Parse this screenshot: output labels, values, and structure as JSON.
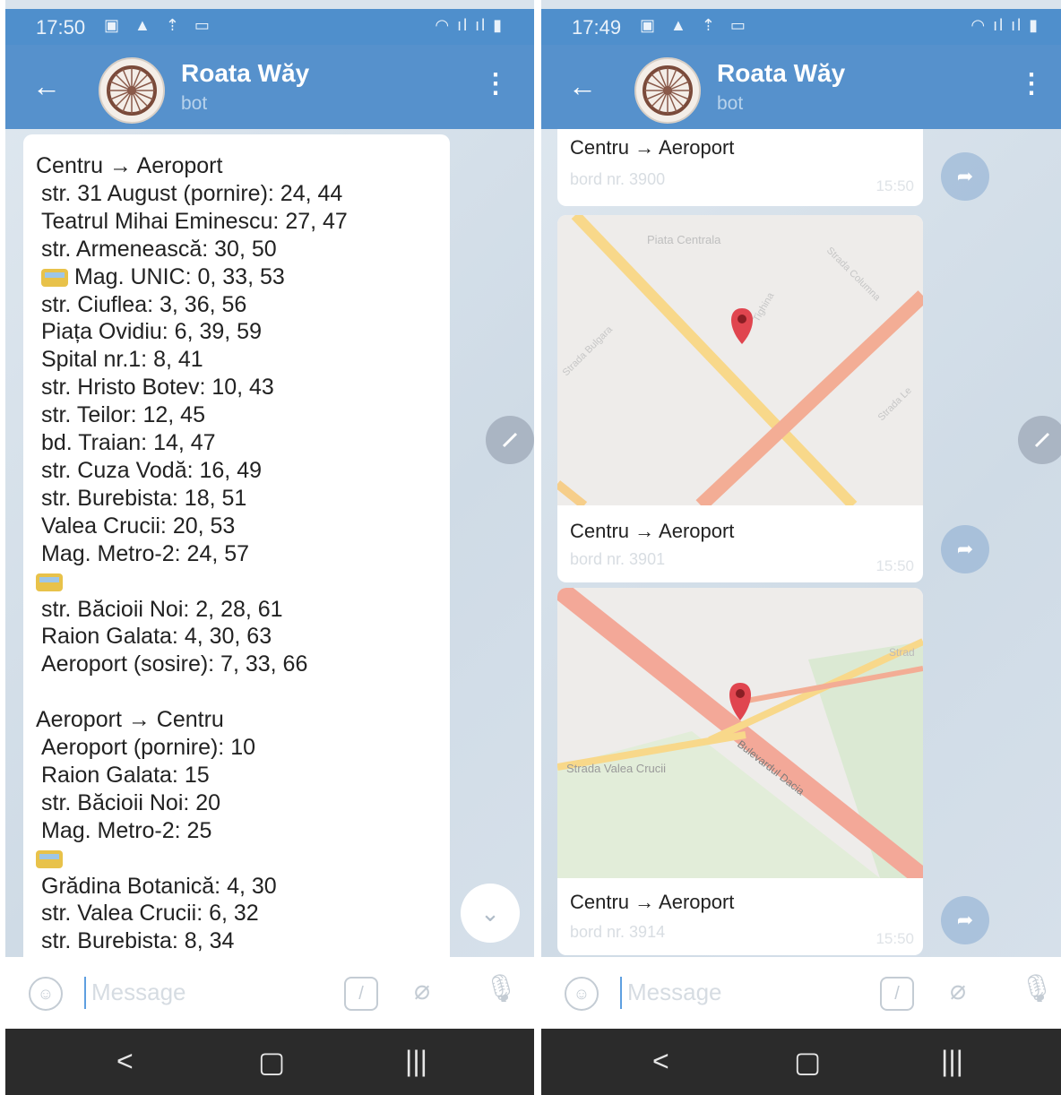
{
  "left": {
    "status": {
      "time": "17:50"
    },
    "chat": {
      "name": "Roata Wăy",
      "subtitle": "bot"
    },
    "message_lines": [
      {
        "text": "Centru → Aeroport",
        "indent": false,
        "bus": false
      },
      {
        "text": "str. 31 August (pornire): 24, 44",
        "indent": true,
        "bus": false
      },
      {
        "text": "Teatrul Mihai Eminescu: 27, 47",
        "indent": true,
        "bus": false
      },
      {
        "text": "str. Armenească: 30, 50",
        "indent": true,
        "bus": false
      },
      {
        "text": " Mag. UNIC: 0, 33, 53",
        "indent": true,
        "bus": true
      },
      {
        "text": "str. Ciuflea: 3, 36, 56",
        "indent": true,
        "bus": false
      },
      {
        "text": "Piața Ovidiu: 6, 39, 59",
        "indent": true,
        "bus": false
      },
      {
        "text": "Spital nr.1: 8, 41",
        "indent": true,
        "bus": false
      },
      {
        "text": "str. Hristo Botev: 10, 43",
        "indent": true,
        "bus": false
      },
      {
        "text": "str. Teilor: 12, 45",
        "indent": true,
        "bus": false
      },
      {
        "text": "bd. Traian: 14, 47",
        "indent": true,
        "bus": false
      },
      {
        "text": "str. Cuza Vodă: 16, 49",
        "indent": true,
        "bus": false
      },
      {
        "text": "str. Burebista: 18, 51",
        "indent": true,
        "bus": false
      },
      {
        "text": "Valea Crucii: 20, 53",
        "indent": true,
        "bus": false
      },
      {
        "text": "Mag. Metro-2: 24, 57",
        "indent": true,
        "bus": false
      },
      {
        "text": "",
        "indent": false,
        "bus": true
      },
      {
        "text": "str. Băcioii Noi: 2, 28, 61",
        "indent": true,
        "bus": false
      },
      {
        "text": "Raion Galata: 4, 30, 63",
        "indent": true,
        "bus": false
      },
      {
        "text": "Aeroport (sosire): 7, 33, 66",
        "indent": true,
        "bus": false
      },
      {
        "text": "",
        "indent": false,
        "bus": false
      },
      {
        "text": "Aeroport → Centru",
        "indent": false,
        "bus": false
      },
      {
        "text": "Aeroport (pornire): 10",
        "indent": true,
        "bus": false
      },
      {
        "text": "Raion Galata: 15",
        "indent": true,
        "bus": false
      },
      {
        "text": "str. Băcioii Noi: 20",
        "indent": true,
        "bus": false
      },
      {
        "text": "Mag. Metro-2: 25",
        "indent": true,
        "bus": false
      },
      {
        "text": "",
        "indent": false,
        "bus": true
      },
      {
        "text": "Grădina Botanică: 4, 30",
        "indent": true,
        "bus": false
      },
      {
        "text": "str. Valea Crucii: 6, 32",
        "indent": true,
        "bus": false
      },
      {
        "text": "str. Burebista: 8, 34",
        "indent": true,
        "bus": false
      }
    ],
    "input_placeholder": "Message"
  },
  "right": {
    "status": {
      "time": "17:49"
    },
    "chat": {
      "name": "Roata Wăy",
      "subtitle": "bot"
    },
    "cards": [
      {
        "title": "Centru → Aeroport",
        "meta": "bord nr. 3900",
        "time": "15:50",
        "map": "none"
      },
      {
        "title": "Centru → Aeroport",
        "meta": "bord nr. 3901",
        "time": "15:50",
        "map": "map1"
      },
      {
        "title": "Centru → Aeroport",
        "meta": "bord nr. 3914",
        "time": "15:50",
        "map": "map2"
      }
    ],
    "map1_labels": {
      "a": "Piata Centrala",
      "b": "Strada Columna",
      "c": "Strada Bulgara",
      "d": "Tighina",
      "e": "Strada Le"
    },
    "map2_labels": {
      "a": "Strada Valea Crucii",
      "b": "Bulevardul Dacia",
      "c": "Strad"
    },
    "input_placeholder": "Message"
  },
  "icons": {
    "back": "arrow-left-icon",
    "menu": "more-vertical-icon",
    "emoji": "smile-icon",
    "commands": "slash-command-icon",
    "attach": "paperclip-icon",
    "mic": "microphone-icon",
    "share": "share-icon",
    "scroll": "chevron-down-icon",
    "edit": "pencil-icon",
    "bus": "bus-emoji-icon"
  },
  "colors": {
    "header": "#5691cc",
    "status_bar": "#4f8fcc",
    "nav_bar": "#2b2b2b",
    "pin": "#e0454f"
  }
}
